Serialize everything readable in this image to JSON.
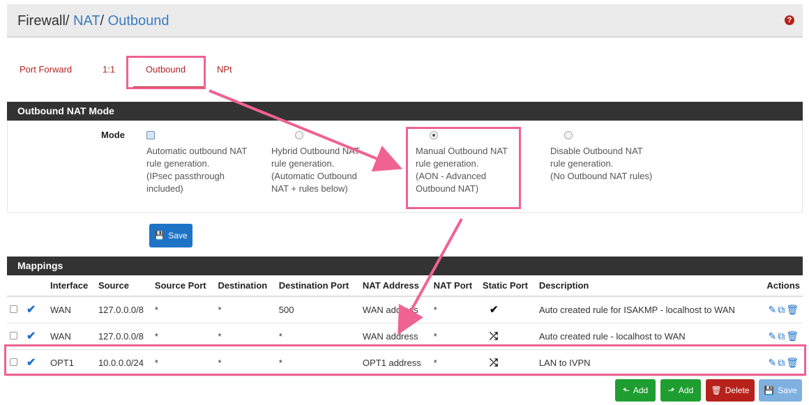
{
  "header": {
    "crumb_firewall": "Firewall",
    "sep1": "/",
    "crumb_nat": "NAT",
    "sep2": "/",
    "crumb_outbound": "Outbound",
    "help_glyph": "?"
  },
  "tabs": {
    "items": [
      {
        "label": "Port Forward"
      },
      {
        "label": "1:1"
      },
      {
        "label": "Outbound"
      },
      {
        "label": "NPt"
      }
    ]
  },
  "mode_panel": {
    "title": "Outbound NAT Mode",
    "mode_label": "Mode",
    "options": [
      {
        "line1": "Automatic outbound NAT",
        "line2": "rule generation.",
        "line3": "(IPsec passthrough",
        "line4": "included)"
      },
      {
        "line1": "Hybrid Outbound NAT",
        "line2": "rule generation.",
        "line3": "(Automatic Outbound",
        "line4": "NAT + rules below)"
      },
      {
        "line1": "Manual Outbound NAT",
        "line2": "rule generation.",
        "line3": "(AON - Advanced",
        "line4": "Outbound NAT)"
      },
      {
        "line1": "Disable Outbound NAT",
        "line2": "rule generation.",
        "line3": "(No Outbound NAT rules)",
        "line4": ""
      }
    ],
    "save_label": "Save"
  },
  "mappings": {
    "title": "Mappings",
    "columns": [
      "Interface",
      "Source",
      "Source Port",
      "Destination",
      "Destination Port",
      "NAT Address",
      "NAT Port",
      "Static Port",
      "Description",
      "Actions"
    ],
    "rows": [
      {
        "interface": "WAN",
        "source": "127.0.0.0/8",
        "source_port": "*",
        "destination": "*",
        "destination_port": "500",
        "nat_address": "WAN address",
        "nat_port": "*",
        "static_port": "✔",
        "description": "Auto created rule for ISAKMP - localhost to WAN"
      },
      {
        "interface": "WAN",
        "source": "127.0.0.0/8",
        "source_port": "*",
        "destination": "*",
        "destination_port": "*",
        "nat_address": "WAN address",
        "nat_port": "*",
        "static_port": "⤮",
        "description": "Auto created rule - localhost to WAN"
      },
      {
        "interface": "OPT1",
        "source": "10.0.0.0/24",
        "source_port": "*",
        "destination": "*",
        "destination_port": "*",
        "nat_address": "OPT1 address",
        "nat_port": "*",
        "static_port": "⤮",
        "description": "LAN to IVPN"
      }
    ]
  },
  "bottom_buttons": {
    "add_top": "Add",
    "add_bottom": "Add",
    "delete": "Delete",
    "save": "Save"
  },
  "colors": {
    "accent": "#1e73c7",
    "tab_active": "#b22222",
    "highlight": "#f06292",
    "panel_heading": "#333333"
  }
}
